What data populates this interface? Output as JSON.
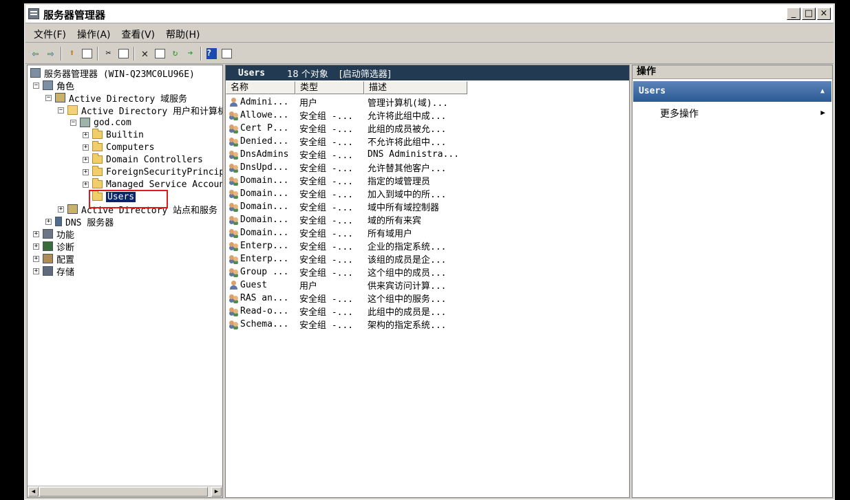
{
  "window": {
    "title": "服务器管理器",
    "buttons": {
      "minimize": "_",
      "maximize": "□",
      "close": "×"
    }
  },
  "menu": [
    "文件(F)",
    "操作(A)",
    "查看(V)",
    "帮助(H)"
  ],
  "toolbar": {
    "icons": [
      "back-icon",
      "forward-icon",
      "up-icon",
      "show-hide-tree-icon",
      "cut-icon",
      "paste-icon",
      "delete-icon",
      "properties-icon",
      "refresh-icon",
      "export-icon",
      "help-icon",
      "console-tree-icon"
    ]
  },
  "tree": {
    "root": "服务器管理器 (WIN-Q23MC0LU96E)",
    "roles": "角色",
    "adds": "Active Directory 域服务",
    "aduc": "Active Directory 用户和计算机",
    "domain": "god.com",
    "builtin": "Builtin",
    "computers": "Computers",
    "dc": "Domain Controllers",
    "fsp": "ForeignSecurityPrincipals",
    "msa": "Managed Service Accounts",
    "users": "Users",
    "sites": "Active Directory 站点和服务",
    "dns": "DNS 服务器",
    "features": "功能",
    "diagnostics": "诊断",
    "configuration": "配置",
    "storage": "存储"
  },
  "main": {
    "title": "Users",
    "count": "18 个对象",
    "filter": "[启动筛选器]",
    "columns": [
      "名称",
      "类型",
      "描述"
    ],
    "rows": [
      {
        "icon": "user",
        "name": "Admini...",
        "type": "用户",
        "desc": "管理计算机(域)..."
      },
      {
        "icon": "group",
        "name": "Allowe...",
        "type": "安全组 -...",
        "desc": "允许将此组中成..."
      },
      {
        "icon": "group",
        "name": "Cert P...",
        "type": "安全组 -...",
        "desc": "此组的成员被允..."
      },
      {
        "icon": "group",
        "name": "Denied...",
        "type": "安全组 -...",
        "desc": "不允许将此组中..."
      },
      {
        "icon": "group",
        "name": "DnsAdmins",
        "type": "安全组 -...",
        "desc": "DNS Administra..."
      },
      {
        "icon": "group",
        "name": "DnsUpd...",
        "type": "安全组 -...",
        "desc": "允许替其他客户..."
      },
      {
        "icon": "group",
        "name": "Domain...",
        "type": "安全组 -...",
        "desc": "指定的域管理员"
      },
      {
        "icon": "group",
        "name": "Domain...",
        "type": "安全组 -...",
        "desc": "加入到域中的所..."
      },
      {
        "icon": "group",
        "name": "Domain...",
        "type": "安全组 -...",
        "desc": "域中所有域控制器"
      },
      {
        "icon": "group",
        "name": "Domain...",
        "type": "安全组 -...",
        "desc": "域的所有来宾"
      },
      {
        "icon": "group",
        "name": "Domain...",
        "type": "安全组 -...",
        "desc": "所有域用户"
      },
      {
        "icon": "group",
        "name": "Enterp...",
        "type": "安全组 -...",
        "desc": "企业的指定系统..."
      },
      {
        "icon": "group",
        "name": "Enterp...",
        "type": "安全组 -...",
        "desc": "该组的成员是企..."
      },
      {
        "icon": "group",
        "name": "Group ...",
        "type": "安全组 -...",
        "desc": "这个组中的成员..."
      },
      {
        "icon": "user",
        "name": "Guest",
        "type": "用户",
        "desc": "供来宾访问计算..."
      },
      {
        "icon": "group",
        "name": "RAS an...",
        "type": "安全组 -...",
        "desc": "这个组中的服务..."
      },
      {
        "icon": "group",
        "name": "Read-o...",
        "type": "安全组 -...",
        "desc": "此组中的成员是..."
      },
      {
        "icon": "group",
        "name": "Schema...",
        "type": "安全组 -...",
        "desc": "架构的指定系统..."
      }
    ]
  },
  "actions": {
    "header": "操作",
    "section": "Users",
    "more": "更多操作"
  },
  "colors": {
    "list_header_bg": "#223b53",
    "selection_bg": "#0a246a",
    "highlight_box": "#e01a1a",
    "actions_section_bg": "#2d5a94"
  }
}
